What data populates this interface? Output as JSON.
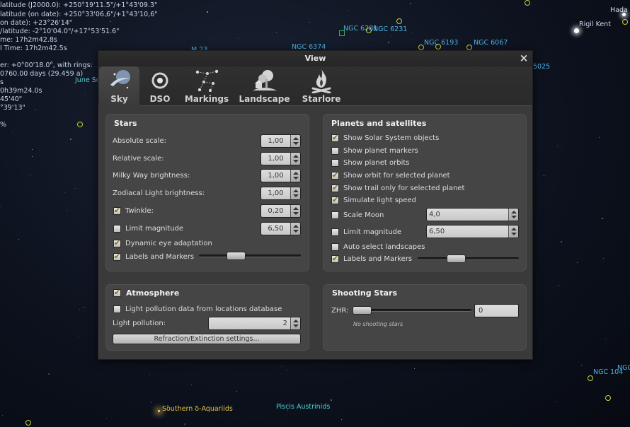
{
  "sky": {
    "info_lines": [
      "latitude (J2000.0): +250°19'11.5\"/+1°43'09.3\"",
      "latitude (on date): +250°33'06.6\"/+1°43'10,6\"",
      "on date): +23°26'14\"",
      "/latitude: -2°10'04.0\"/+17°53'51.6\"",
      "me: 17h2m42.8s",
      "l Time: 17h2m42.5s",
      "er: +0°00'18.0\", with rings:",
      "0760.00 days (29.459 a)",
      "s",
      "0h39m24.0s",
      "45'40\"",
      "°39'13\"",
      "%"
    ],
    "labels": [
      {
        "text": "NGC 6281",
        "color": "#4fb0e0"
      },
      {
        "text": "NGC 6231",
        "color": "#4fb0e0"
      },
      {
        "text": "NGC 6374",
        "color": "#4fb0e0"
      },
      {
        "text": "NGC 6193",
        "color": "#4fb0e0"
      },
      {
        "text": "NGC 6067",
        "color": "#4fb0e0"
      },
      {
        "text": "M 23",
        "color": "#4fb0e0"
      },
      {
        "text": "Hada",
        "color": "#cfd8e6"
      },
      {
        "text": "Rigil Kent",
        "color": "#cfd8e6"
      },
      {
        "text": "June Scuti",
        "color": "#4fd0d0"
      },
      {
        "text": "5025",
        "color": "#4fb0e0"
      },
      {
        "text": "Southern δ-Aquariids",
        "color": "#e0c040"
      },
      {
        "text": "Piscis Austrinids",
        "color": "#4fd0d0"
      },
      {
        "text": "NGC 104",
        "color": "#4fb0e0"
      },
      {
        "text": "NGC",
        "color": "#4fb0e0"
      }
    ]
  },
  "dialog": {
    "title": "View",
    "close_glyph": "×",
    "tabs": [
      {
        "label": "Sky",
        "icon": "sky-icon",
        "active": true
      },
      {
        "label": "DSO",
        "icon": "galaxy-icon",
        "active": false
      },
      {
        "label": "Markings",
        "icon": "constellation-icon",
        "active": false
      },
      {
        "label": "Landscape",
        "icon": "landscape-icon",
        "active": false
      },
      {
        "label": "Starlore",
        "icon": "campfire-icon",
        "active": false
      }
    ],
    "stars": {
      "title": "Stars",
      "absolute_scale": {
        "label": "Absolute scale:",
        "value": "1,00"
      },
      "relative_scale": {
        "label": "Relative scale:",
        "value": "1,00"
      },
      "milky_way": {
        "label": "Milky Way brightness:",
        "value": "1,00"
      },
      "zodiacal": {
        "label": "Zodiacal Light brightness:",
        "value": "1,00"
      },
      "twinkle": {
        "label": "Twinkle:",
        "checked": true,
        "value": "0,20"
      },
      "limit_magnitude": {
        "label": "Limit magnitude",
        "checked": false,
        "value": "6,50"
      },
      "dynamic_eye": {
        "label": "Dynamic eye adaptation",
        "checked": true
      },
      "labels_markers": {
        "label": "Labels and Markers",
        "checked": true,
        "slider_fraction": 0.33
      }
    },
    "planets": {
      "title": "Planets and satellites",
      "show_solar_system": {
        "label": "Show Solar System objects",
        "checked": true
      },
      "show_markers": {
        "label": "Show planet markers",
        "checked": false
      },
      "show_orbits": {
        "label": "Show planet orbits",
        "checked": false
      },
      "show_orbit_selected": {
        "label": "Show orbit for selected planet",
        "checked": true
      },
      "show_trail": {
        "label": "Show trail only for selected planet",
        "checked": true
      },
      "simulate_light": {
        "label": "Simulate light speed",
        "checked": true
      },
      "scale_moon": {
        "label": "Scale Moon",
        "checked": false,
        "value": "4,0"
      },
      "limit_magnitude": {
        "label": "Limit magnitude",
        "checked": false,
        "value": "6,50"
      },
      "auto_select": {
        "label": "Auto select landscapes",
        "checked": false
      },
      "labels_markers": {
        "label": "Labels and Markers",
        "checked": true,
        "slider_fraction": 0.35
      }
    },
    "atmosphere": {
      "title": "Atmosphere",
      "checked": true,
      "light_pollution_db": {
        "label": "Light pollution data from locations database",
        "checked": false
      },
      "light_pollution": {
        "label": "Light pollution:",
        "value": "2"
      },
      "refraction_button": "Refraction/Extinction settings..."
    },
    "shooting": {
      "title": "Shooting Stars",
      "zhr_label": "ZHR:",
      "zhr_value": "0",
      "slider_fraction": 0.0,
      "note": "No shooting stars"
    }
  },
  "colors": {
    "check": "#8a6a10",
    "panel": "#454545",
    "dialog": "#3a3a3a"
  }
}
